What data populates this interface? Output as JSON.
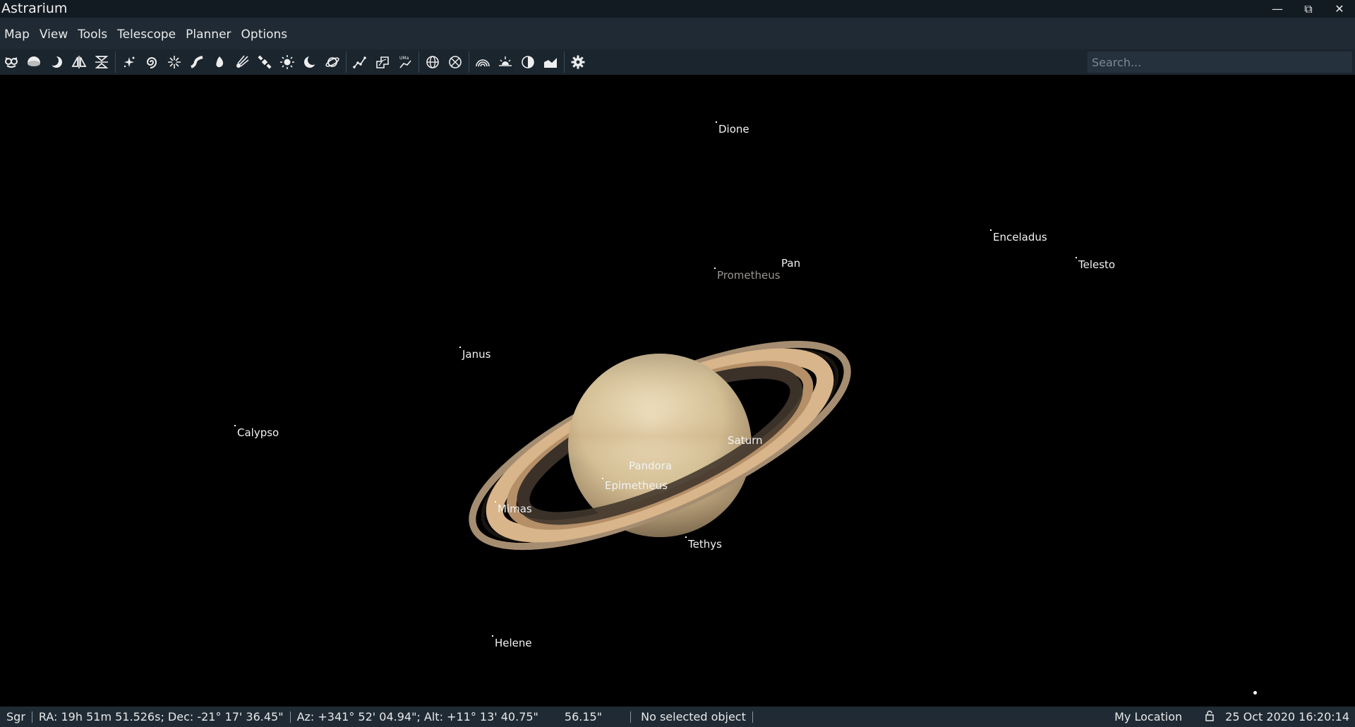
{
  "app": {
    "title": "Astrarium"
  },
  "window_controls": {
    "minimize": "—",
    "restore": "⧉",
    "close": "✕"
  },
  "menu": [
    "Map",
    "View",
    "Tools",
    "Telescope",
    "Planner",
    "Options"
  ],
  "toolbar": {
    "search_placeholder": "Search...",
    "buttons": [
      "owl-icon",
      "horizon-ground-icon",
      "moon-phase-icon",
      "mirror-horizontal-icon",
      "mirror-vertical-icon",
      "stars-icon",
      "galaxy-icon",
      "star-cluster-icon",
      "milky-way-icon",
      "nebula-icon",
      "comet-icon",
      "satellite-icon",
      "sun-icon",
      "moon-icon",
      "planet-icon",
      "constellation-lines-icon",
      "constellation-borders-icon",
      "constellation-labels-icon",
      "equatorial-grid-icon",
      "horizontal-grid-icon",
      "atmosphere-icon",
      "sunrise-icon",
      "earthshine-icon",
      "landscape-icon",
      "settings-icon"
    ]
  },
  "sky": {
    "planet": {
      "name": "Saturn",
      "colors": {
        "body": "#d8c49c",
        "ring": "#c9a57d",
        "ring_dark": "#3a3028"
      }
    },
    "moons": [
      {
        "name": "Dione"
      },
      {
        "name": "Enceladus"
      },
      {
        "name": "Telesto"
      },
      {
        "name": "Pan"
      },
      {
        "name": "Prometheus"
      },
      {
        "name": "Janus"
      },
      {
        "name": "Calypso"
      },
      {
        "name": "Pandora"
      },
      {
        "name": "Epimetheus"
      },
      {
        "name": "Mimas"
      },
      {
        "name": "Tethys"
      },
      {
        "name": "Helene"
      }
    ]
  },
  "status": {
    "constellation": "Sgr",
    "equatorial": "RA: 19h 51m 51.526s; Dec: -21° 17' 36.45\"",
    "horizontal": "Az: +341° 52' 04.94\"; Alt: +11° 13' 40.75\"",
    "fov": "56.15\"",
    "selected_object": "No selected object",
    "location": "My Location",
    "datetime": "25 Oct 2020 16:20:14"
  }
}
